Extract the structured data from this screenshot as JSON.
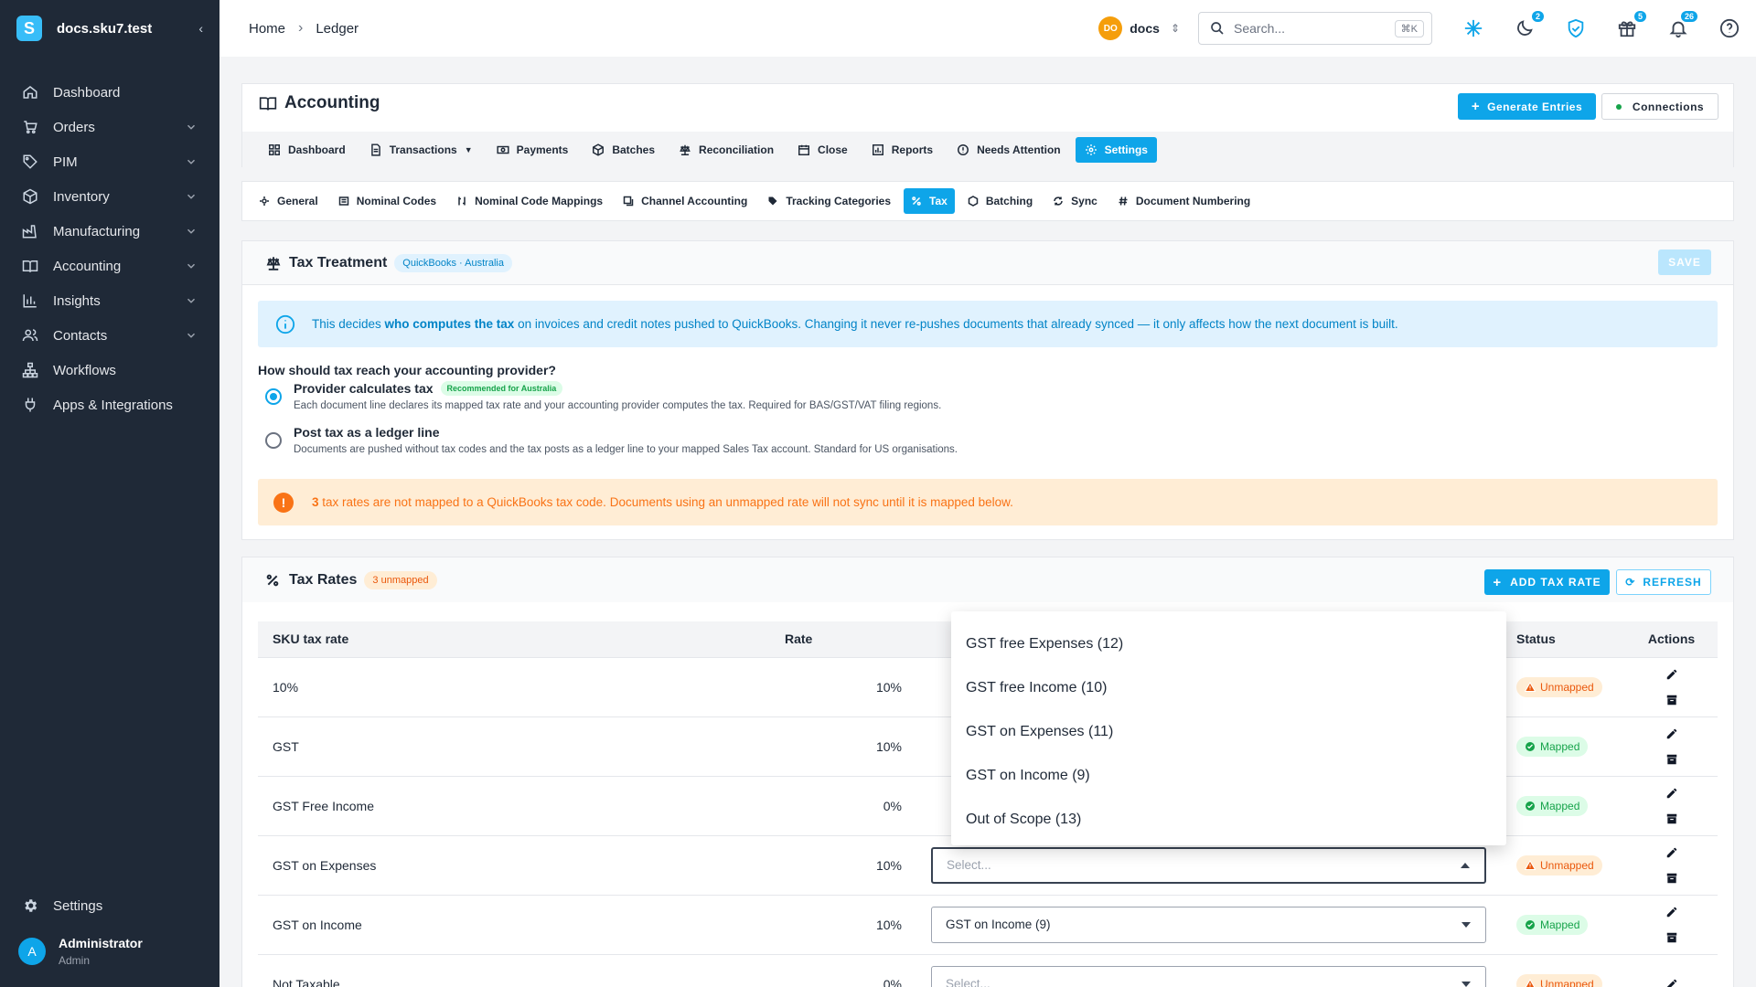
{
  "sidebar": {
    "title": "docs.sku7.test",
    "items": [
      {
        "label": "Dashboard",
        "icon": "home-icon",
        "expandable": false
      },
      {
        "label": "Orders",
        "icon": "cart-icon",
        "expandable": true
      },
      {
        "label": "PIM",
        "icon": "tag-icon",
        "expandable": true
      },
      {
        "label": "Inventory",
        "icon": "box-icon",
        "expandable": true
      },
      {
        "label": "Manufacturing",
        "icon": "factory-icon",
        "expandable": true
      },
      {
        "label": "Accounting",
        "icon": "book-icon",
        "expandable": true
      },
      {
        "label": "Insights",
        "icon": "chart-icon",
        "expandable": true
      },
      {
        "label": "Contacts",
        "icon": "people-icon",
        "expandable": true
      },
      {
        "label": "Workflows",
        "icon": "sitemap-icon",
        "expandable": false
      },
      {
        "label": "Apps & Integrations",
        "icon": "plug-icon",
        "expandable": false
      }
    ],
    "settings_label": "Settings",
    "user": {
      "initial": "A",
      "name": "Administrator",
      "role": "Admin"
    }
  },
  "topbar": {
    "breadcrumb": [
      "Home",
      "Ledger"
    ],
    "workspace_initials": "DO",
    "workspace_name": "docs",
    "search_placeholder": "Search...",
    "search_shortcut": "⌘K",
    "badges": {
      "moon": "2",
      "gift": "5",
      "bell": "26"
    }
  },
  "header": {
    "title": "Accounting",
    "generate_label": "Generate Entries",
    "connections_label": "Connections",
    "tabs": [
      {
        "label": "Dashboard",
        "icon": "grid-icon"
      },
      {
        "label": "Transactions",
        "icon": "document-icon",
        "dropdown": true
      },
      {
        "label": "Payments",
        "icon": "cash-icon"
      },
      {
        "label": "Batches",
        "icon": "cube-icon"
      },
      {
        "label": "Reconciliation",
        "icon": "scale-icon"
      },
      {
        "label": "Close",
        "icon": "calendar-icon"
      },
      {
        "label": "Reports",
        "icon": "report-icon"
      },
      {
        "label": "Needs Attention",
        "icon": "alert-circle-icon"
      },
      {
        "label": "Settings",
        "icon": "gear-icon",
        "active": true
      }
    ]
  },
  "subtabs": [
    {
      "label": "General",
      "icon": "gear-icon"
    },
    {
      "label": "Nominal Codes",
      "icon": "list-icon"
    },
    {
      "label": "Nominal Code Mappings",
      "icon": "link-icon"
    },
    {
      "label": "Channel Accounting",
      "icon": "channel-icon"
    },
    {
      "label": "Tracking Categories",
      "icon": "tag-icon"
    },
    {
      "label": "Tax",
      "icon": "percent-icon",
      "active": true
    },
    {
      "label": "Batching",
      "icon": "cube-icon"
    },
    {
      "label": "Sync",
      "icon": "sync-icon"
    },
    {
      "label": "Document Numbering",
      "icon": "hash-icon"
    }
  ],
  "tax_treatment": {
    "title": "Tax Treatment",
    "provider_pill": "QuickBooks · Australia",
    "save_label": "SAVE",
    "info_pre": "This decides ",
    "info_bold": "who computes the tax",
    "info_post": " on invoices and credit notes pushed to QuickBooks. Changing it never re-pushes documents that already synced — it only affects how the next document is built.",
    "question": "How should tax reach your accounting provider?",
    "options": [
      {
        "title": "Provider calculates tax",
        "badge": "Recommended for Australia",
        "desc": "Each document line declares its mapped tax rate and your accounting provider computes the tax. Required for BAS/GST/VAT filing regions.",
        "selected": true
      },
      {
        "title": "Post tax as a ledger line",
        "desc": "Documents are pushed without tax codes and the tax posts as a ledger line to your mapped Sales Tax account. Standard for US organisations.",
        "selected": false
      }
    ],
    "warning_count": "3",
    "warning_text": " tax rates are not mapped to a QuickBooks tax code. Documents using an unmapped rate will not sync until it is mapped below."
  },
  "tax_rates": {
    "title": "Tax Rates",
    "unmapped_pill": "3 unmapped",
    "add_label": "ADD TAX RATE",
    "refresh_label": "REFRESH",
    "columns": {
      "name": "SKU tax rate",
      "rate": "Rate",
      "status": "Status",
      "actions": "Actions"
    },
    "select_placeholder": "Select...",
    "rows": [
      {
        "name": "10%",
        "rate": "10%",
        "mapping": "",
        "status": "Unmapped"
      },
      {
        "name": "GST",
        "rate": "10%",
        "mapping": "",
        "status": "Mapped"
      },
      {
        "name": "GST Free Income",
        "rate": "0%",
        "mapping": "",
        "status": "Mapped"
      },
      {
        "name": "GST on Expenses",
        "rate": "10%",
        "mapping": "",
        "status": "Unmapped"
      },
      {
        "name": "GST on Income",
        "rate": "10%",
        "mapping": "GST on Income (9)",
        "status": "Mapped"
      },
      {
        "name": "Not Taxable",
        "rate": "0%",
        "mapping": "",
        "status": "Unmapped"
      }
    ],
    "dropdown_options": [
      "GST free Expenses (12)",
      "GST free Income (10)",
      "GST on Expenses (11)",
      "GST on Income (9)",
      "Out of Scope (13)"
    ]
  },
  "colors": {
    "accent": "#0ea5e9",
    "sidebar": "#1f2937",
    "warning": "#f97316",
    "success": "#16a34a"
  }
}
